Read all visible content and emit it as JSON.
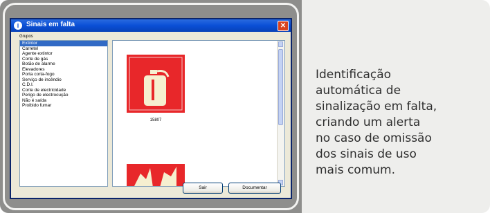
{
  "dialog": {
    "title": "Sinais em falta",
    "close_glyph": "✕",
    "app_icon_glyph": "i",
    "group_label": "Grupos",
    "list_items": [
      {
        "label": "Extintor",
        "selected": true
      },
      {
        "label": "Carretel",
        "selected": false
      },
      {
        "label": "Agente extintor",
        "selected": false
      },
      {
        "label": "Corte de gás",
        "selected": false
      },
      {
        "label": "Botão de alarme",
        "selected": false
      },
      {
        "label": "Elevadores",
        "selected": false
      },
      {
        "label": "Porta corta-fogo",
        "selected": false
      },
      {
        "label": "Serviço de incêndio",
        "selected": false
      },
      {
        "label": "C.D.I.",
        "selected": false
      },
      {
        "label": "Corte de electricidade",
        "selected": false
      },
      {
        "label": "Perigo de electrocução",
        "selected": false
      },
      {
        "label": "Não é saída",
        "selected": false
      },
      {
        "label": "Proibido fumar",
        "selected": false
      }
    ],
    "preview": {
      "sign_caption": "15807",
      "sign_icon": "fire-extinguisher-icon"
    },
    "buttons": {
      "ok": "Sair",
      "cancel": "Documentar"
    }
  },
  "description": {
    "lines": [
      "Identificação",
      "automática de",
      "sinalização em falta,",
      "criando um alerta",
      "no caso de omissão",
      "dos sinais de uso",
      "mais comum."
    ]
  },
  "colors": {
    "panel_gray": "#8e8e8c",
    "card_bg": "#eeeeec",
    "sign_red": "#e8272a",
    "xp_titlebar": "#0a4fd6",
    "selection_blue": "#316ac5"
  }
}
